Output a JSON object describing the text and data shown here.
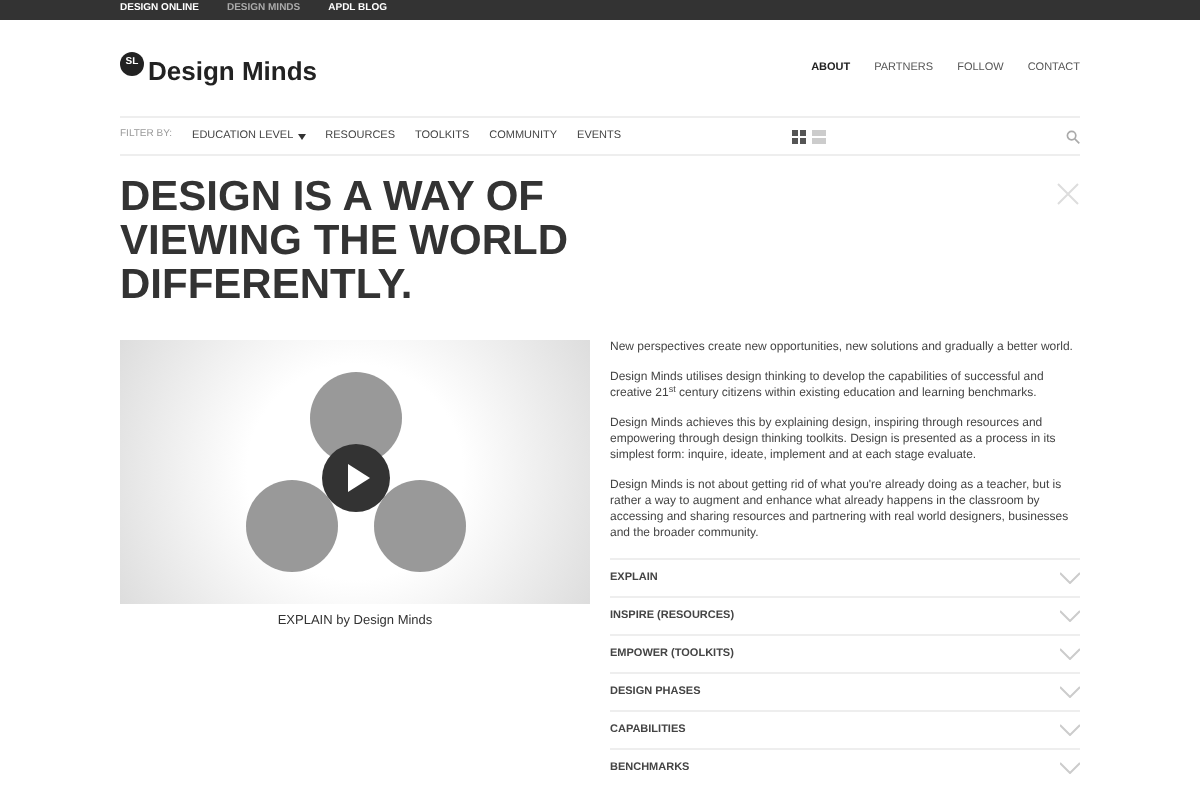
{
  "top_bar": {
    "links": [
      {
        "label": "DESIGN ONLINE",
        "selected": false
      },
      {
        "label": "DESIGN MINDS",
        "selected": true
      },
      {
        "label": "APDL BLOG",
        "selected": false
      }
    ]
  },
  "header": {
    "logo_badge": "SL",
    "logo_text": "Design Minds",
    "nav": [
      {
        "label": "ABOUT",
        "selected": true
      },
      {
        "label": "PARTNERS",
        "selected": false
      },
      {
        "label": "FOLLOW",
        "selected": false
      },
      {
        "label": "CONTACT",
        "selected": false
      }
    ]
  },
  "filter_bar": {
    "label": "FILTER BY:",
    "items": [
      {
        "label": "EDUCATION LEVEL",
        "dropdown": true
      },
      {
        "label": "RESOURCES",
        "dropdown": false
      },
      {
        "label": "TOOLKITS",
        "dropdown": false
      },
      {
        "label": "COMMUNITY",
        "dropdown": false
      },
      {
        "label": "EVENTS",
        "dropdown": false
      }
    ],
    "views": [
      {
        "kind": "grid",
        "selected": true
      },
      {
        "kind": "list",
        "selected": false
      }
    ]
  },
  "headline": "DESIGN IS A WAY OF VIEWING THE WORLD DIFFERENTLY.",
  "video": {
    "caption": "EXPLAIN by Design Minds"
  },
  "paragraphs": [
    "New perspectives create new opportunities, new solutions and gradually a better world.",
    "Design Minds utilises design thinking to develop the capabilities of successful and creative 21$^{st}$ century citizens within existing education and learning benchmarks.",
    "Design Minds achieves this by explaining design, inspiring through resources and empowering through design thinking toolkits. Design is presented as a process in its simplest form: inquire, ideate, implement and at each stage evaluate.",
    "Design Minds is not about getting rid of what you're already doing as a teacher, but is rather a way to augment and enhance what already happens in the classroom by accessing and sharing resources and partnering with real world designers, businesses and the broader community."
  ],
  "accordion": [
    {
      "label": "EXPLAIN",
      "expanded": false
    },
    {
      "label": "INSPIRE (RESOURCES)",
      "expanded": false
    },
    {
      "label": "EMPOWER (TOOLKITS)",
      "expanded": false
    },
    {
      "label": "DESIGN PHASES",
      "expanded": false
    },
    {
      "label": "CAPABILITIES",
      "expanded": false
    },
    {
      "label": "BENCHMARKS",
      "expanded": false
    }
  ]
}
